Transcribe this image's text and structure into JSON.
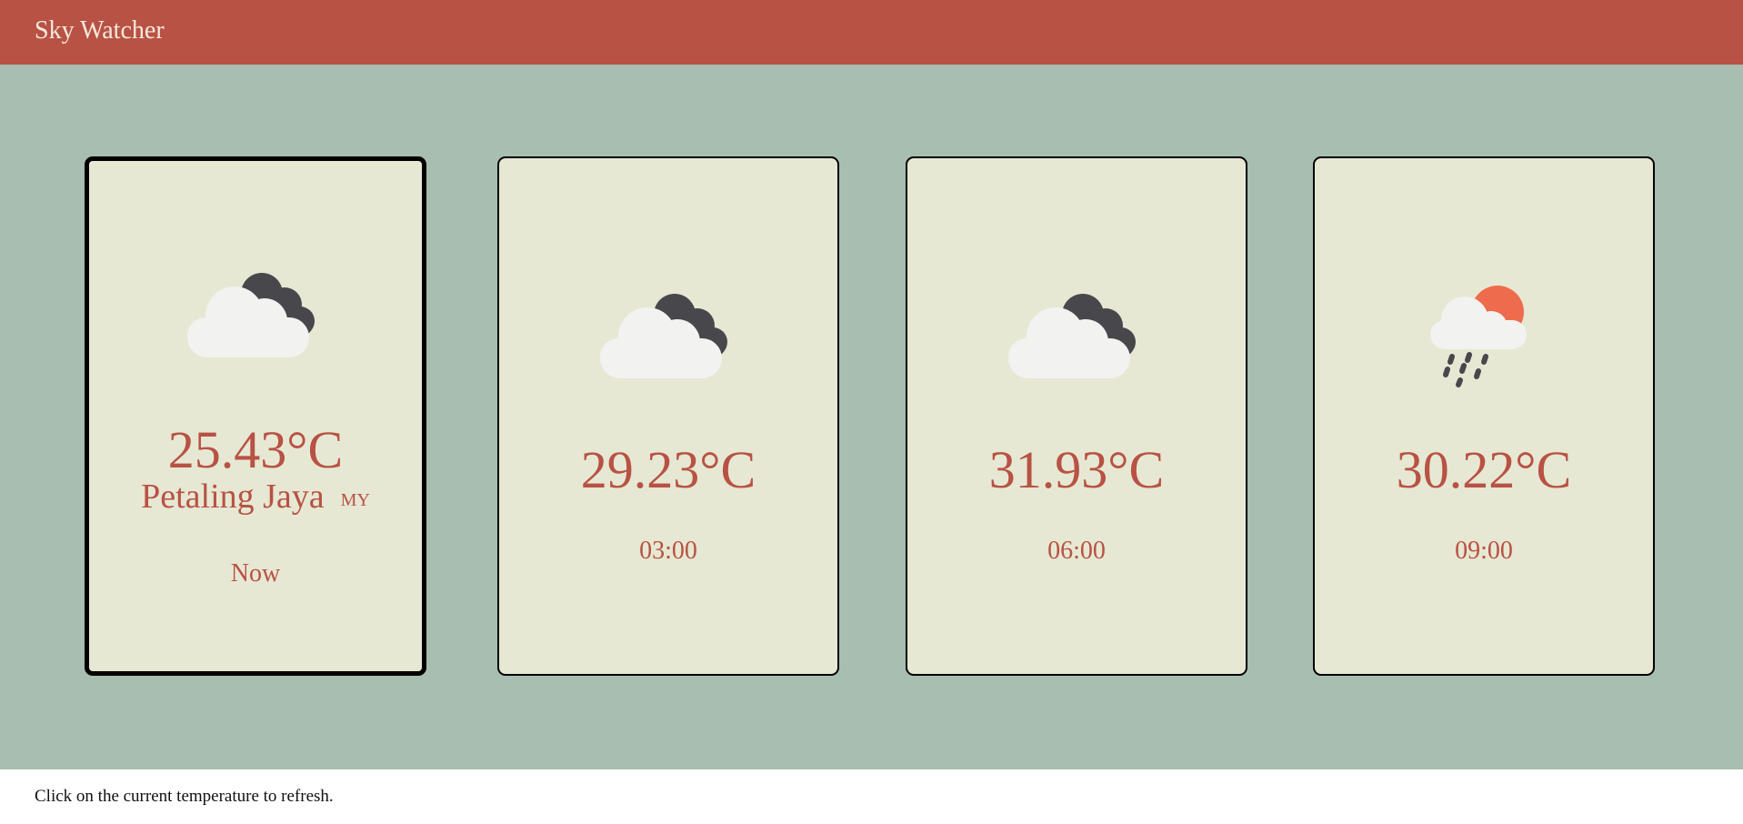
{
  "header": {
    "title": "Sky Watcher"
  },
  "colors": {
    "header_bg": "#b85244",
    "main_bg": "#a7beb0",
    "card_bg": "#e6e8d3",
    "accent_text": "#b85244",
    "sun": "#ee6c4d",
    "dark_cloud": "#48474b",
    "light_cloud": "#f2f2f0"
  },
  "cards": [
    {
      "temp": "25.43°C",
      "city": "Petaling Jaya",
      "country": "MY",
      "time": "Now",
      "icon": "cloudy-icon",
      "current": true
    },
    {
      "temp": "29.23°C",
      "time": "03:00",
      "icon": "cloudy-icon"
    },
    {
      "temp": "31.93°C",
      "time": "06:00",
      "icon": "cloudy-icon"
    },
    {
      "temp": "30.22°C",
      "time": "09:00",
      "icon": "sun-rain-icon"
    }
  ],
  "footer": {
    "hint": "Click on the current temperature to refresh."
  }
}
